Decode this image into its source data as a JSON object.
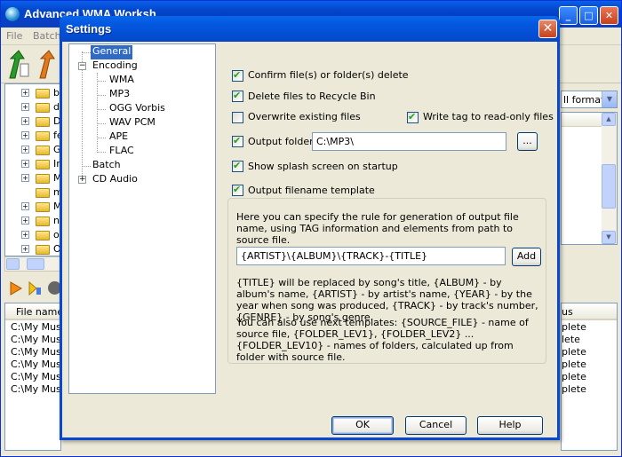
{
  "main": {
    "title": "Advanced WMA Worksh",
    "menu": [
      "File",
      "Batch"
    ],
    "tree": [
      "ba",
      "dis",
      "Do",
      "fe",
      "Gr",
      "Int",
      "MP",
      "mu",
      "My",
      "ne",
      "ora",
      "OX"
    ],
    "file_list": {
      "header": "File name",
      "rows": [
        "C:\\My Music",
        "C:\\My Music",
        "C:\\My Music",
        "C:\\My Music",
        "C:\\My Music",
        "C:\\My Music"
      ]
    },
    "format_combo": "ll formats",
    "status_header": "us",
    "status_rows": [
      "plete",
      "lete",
      "plete",
      "plete",
      "plete",
      "plete"
    ]
  },
  "dialog": {
    "title": "Settings",
    "nav": [
      {
        "label": "General",
        "selected": true
      },
      {
        "label": "Encoding",
        "expanded": true
      },
      {
        "label": "WMA"
      },
      {
        "label": "MP3"
      },
      {
        "label": "OGG Vorbis"
      },
      {
        "label": "WAV PCM"
      },
      {
        "label": "APE"
      },
      {
        "label": "FLAC"
      },
      {
        "label": "Batch"
      },
      {
        "label": "CD Audio",
        "expanded": false
      }
    ],
    "options": {
      "confirm": {
        "label": "Confirm file(s) or folder(s) delete",
        "checked": true
      },
      "recycle": {
        "label": "Delete files to Recycle Bin",
        "checked": true
      },
      "overwrite": {
        "label": "Overwrite existing files",
        "checked": false
      },
      "writetag": {
        "label": "Write tag to read-only files",
        "checked": true
      },
      "output_folder": {
        "label": "Output folder :",
        "checked": true,
        "value": "C:\\MP3\\",
        "browse": "..."
      },
      "splash": {
        "label": "Show splash screen on startup",
        "checked": true
      },
      "template": {
        "label": "Output filename template",
        "checked": true
      }
    },
    "template_group": {
      "intro": "Here you can specify the rule for generation of output file name, using TAG information and elements from path to source file.",
      "value": "{ARTIST}\\{ALBUM}\\{TRACK}-{TITLE}",
      "add_label": "Add",
      "help1": "{TITLE} will be replaced by song's title, {ALBUM} - by album's name, {ARTIST} - by artist's name, {YEAR} - by the year when song was produced, {TRACK} - by track's number, {GENRE} - by song's genre.",
      "help2": "You can also use next templates: {SOURCE_FILE} - name of source file, {FOLDER_LEV1}, {FOLDER_LEV2} ... {FOLDER_LEV10} - names of folders, calculated up from folder with source file."
    },
    "buttons": {
      "ok": "OK",
      "cancel": "Cancel",
      "help": "Help"
    }
  }
}
